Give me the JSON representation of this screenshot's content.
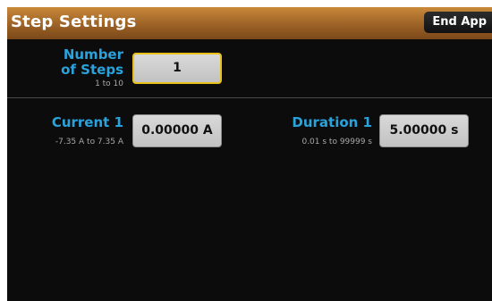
{
  "header": {
    "title": "Step Settings",
    "end_app_label": "End App"
  },
  "steps": {
    "label_line1": "Number",
    "label_line2": "of Steps",
    "range": "1 to 10",
    "value": "1"
  },
  "current": {
    "label": "Current 1",
    "range": "-7.35 A to 7.35 A",
    "value": "0.00000 A"
  },
  "duration": {
    "label": "Duration 1",
    "range": "0.01 s to 99999 s",
    "value": "5.00000 s"
  },
  "colors": {
    "title_bar": "#a4682a",
    "label_text": "#2aa3dc",
    "selected_border": "#e8c21a",
    "background": "#0c0c0c"
  }
}
